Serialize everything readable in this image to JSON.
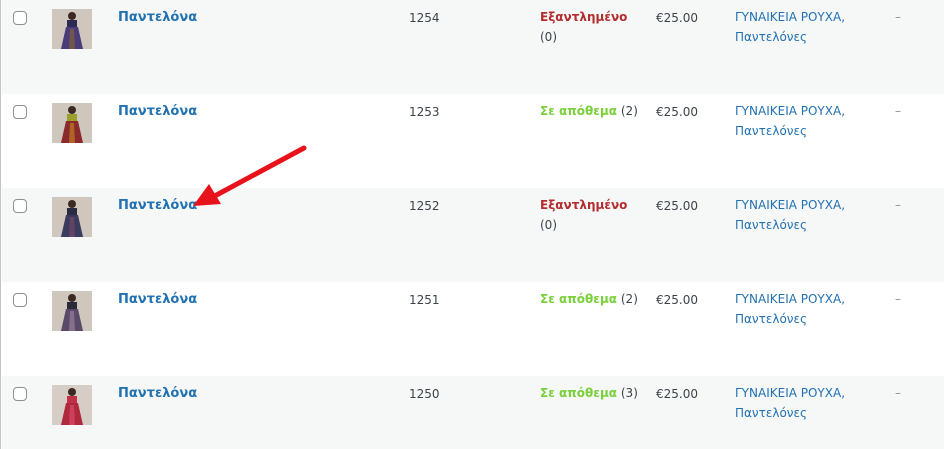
{
  "rows": [
    {
      "name": "Παντελόνα",
      "sku": "1254",
      "stock_status": "Εξαντλημένο",
      "stock_count": "(0)",
      "stock_type": "out",
      "price": "€25.00",
      "category_1": "ΓΥΝΑΙΚΕΙΑ ΡΟΥΧΑ,",
      "category_2": "Παντελόνες",
      "extra": "–",
      "thumb_color": "#4a3b7a"
    },
    {
      "name": "Παντελόνα",
      "sku": "1253",
      "stock_status": "Σε απόθεμα",
      "stock_count": "(2)",
      "stock_type": "in",
      "price": "€25.00",
      "category_1": "ΓΥΝΑΙΚΕΙΑ ΡΟΥΧΑ,",
      "category_2": "Παντελόνες",
      "extra": "–",
      "thumb_color": "#8a2a2a"
    },
    {
      "name": "Παντελόνα",
      "sku": "1252",
      "stock_status": "Εξαντλημένο",
      "stock_count": "(0)",
      "stock_type": "out",
      "price": "€25.00",
      "category_1": "ΓΥΝΑΙΚΕΙΑ ΡΟΥΧΑ,",
      "category_2": "Παντελόνες",
      "extra": "–",
      "thumb_color": "#3b3b5e"
    },
    {
      "name": "Παντελόνα",
      "sku": "1251",
      "stock_status": "Σε απόθεμα",
      "stock_count": "(2)",
      "stock_type": "in",
      "price": "€25.00",
      "category_1": "ΓΥΝΑΙΚΕΙΑ ΡΟΥΧΑ,",
      "category_2": "Παντελόνες",
      "extra": "–",
      "thumb_color": "#5a4a6a"
    },
    {
      "name": "Παντελόνα",
      "sku": "1250",
      "stock_status": "Σε απόθεμα",
      "stock_count": "(3)",
      "stock_type": "in",
      "price": "€25.00",
      "category_1": "ΓΥΝΑΙΚΕΙΑ ΡΟΥΧΑ,",
      "category_2": "Παντελόνες",
      "extra": "–",
      "thumb_color": "#b0283c"
    }
  ],
  "colors": {
    "link": "#2271b1",
    "out_of_stock": "#b32d2e",
    "in_stock": "#7ad03a",
    "annotation_arrow": "#e8121b"
  }
}
